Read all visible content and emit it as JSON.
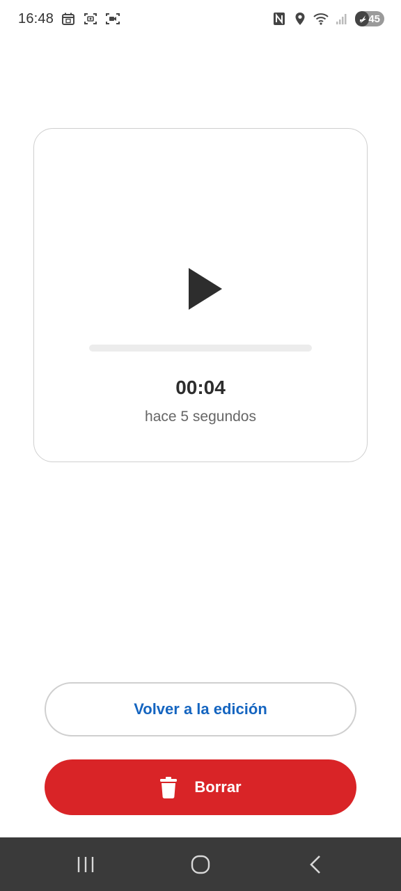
{
  "status_bar": {
    "time": "16:48",
    "battery_level": "45",
    "icons": [
      "calendar-icon",
      "screenshot-icon",
      "screen-record-icon",
      "nfc-icon",
      "location-icon",
      "wifi-icon",
      "signal-icon",
      "battery-icon"
    ]
  },
  "player": {
    "duration": "00:04",
    "recorded_ago": "hace 5 segundos",
    "progress_percent": 0,
    "play_icon": "play-icon"
  },
  "actions": {
    "back_label": "Volver a la edición",
    "delete_label": "Borrar",
    "delete_icon": "trash-icon"
  },
  "navigation": {
    "icons": [
      "recent-apps-icon",
      "home-icon",
      "back-icon"
    ]
  },
  "colors": {
    "accent_blue": "#1565c0",
    "delete_red": "#d92427",
    "nav_bar": "#3a3a3a"
  }
}
